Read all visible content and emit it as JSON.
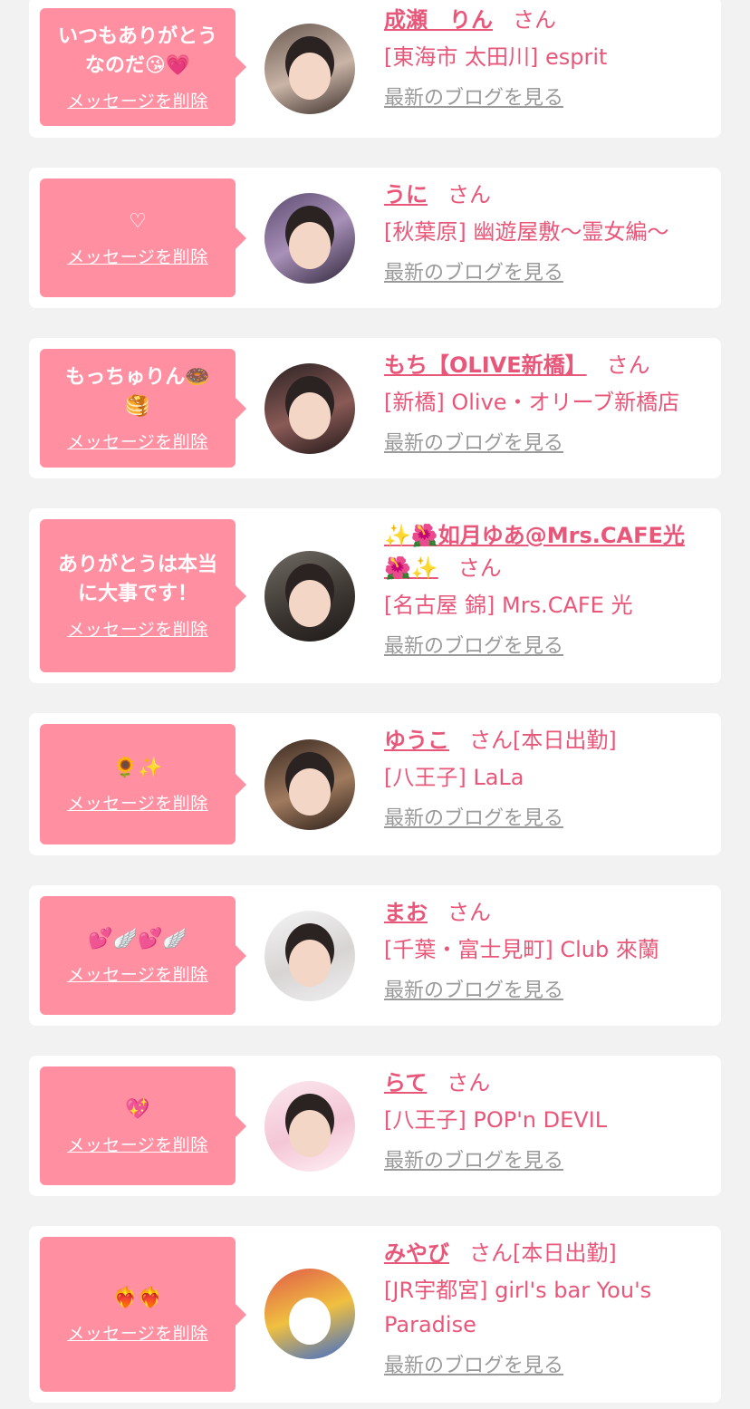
{
  "delete_label": "メッセージを削除",
  "san_label": "さん",
  "blog_label": "最新のブログを見る",
  "items": [
    {
      "message": "いつもありがとう\nなのだ😘💗",
      "name": "成瀬　りん",
      "extra": "",
      "shop": "[東海市 太田川] esprit"
    },
    {
      "message": "♡",
      "name": "うに",
      "extra": "",
      "shop": "[秋葉原] 幽遊屋敷～霊女編～"
    },
    {
      "message": "もっちゅりん🍩\n🥞",
      "name": "もち【OLIVE新橋】",
      "extra": "",
      "shop": "[新橋] Olive・オリーブ新橋店"
    },
    {
      "message": "ありがとうは本当\nに大事です！",
      "name": "✨🌺如月ゆあ@Mrs.CAFE光🌺✨",
      "extra": "",
      "shop": "[名古屋 錦] Mrs.CAFE 光"
    },
    {
      "message": "🌻✨",
      "name": "ゆうこ",
      "extra": "[本日出勤]",
      "shop": "[八王子] LaLa"
    },
    {
      "message": "💕🪽💕🪽",
      "name": "まお",
      "extra": "",
      "shop": "[千葉・富士見町] Club 來蘭"
    },
    {
      "message": "💖",
      "name": "らて",
      "extra": "",
      "shop": "[八王子] POP'n DEVIL"
    },
    {
      "message": "❤️‍🔥❤️‍🔥",
      "name": "みやび",
      "extra": "[本日出勤]",
      "shop": "[JR宇都宮] girl's bar You's Paradise"
    }
  ]
}
